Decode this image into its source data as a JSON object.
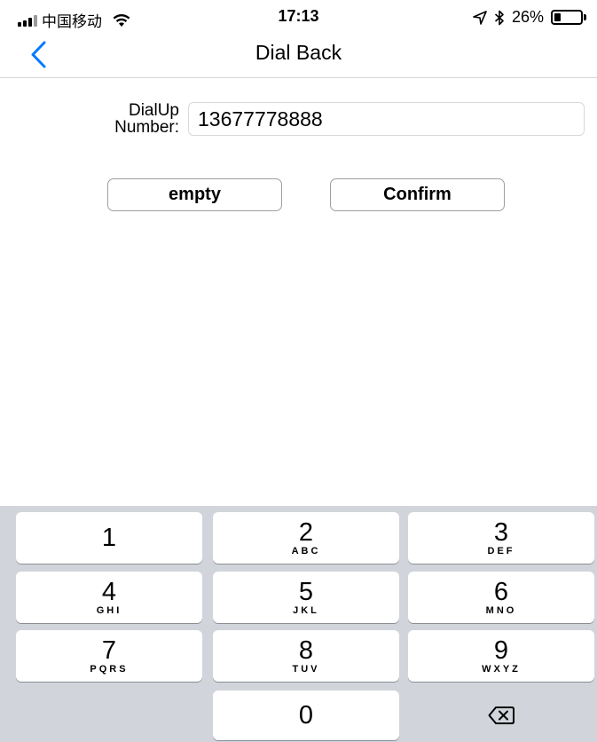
{
  "status_bar": {
    "carrier": "中国移动",
    "time": "17:13",
    "battery_text": "26%",
    "battery_level": 0.26,
    "icons": [
      "signal-icon",
      "wifi-icon",
      "location-icon",
      "bluetooth-icon",
      "battery-icon"
    ]
  },
  "nav": {
    "title": "Dial Back",
    "back_icon": "chevron-left-icon",
    "accent_color": "#007aff"
  },
  "form": {
    "label_line1": "DialUp",
    "label_line2": "Number:",
    "input_value": "13677778888"
  },
  "buttons": {
    "empty_label": "empty",
    "confirm_label": "Confirm"
  },
  "keypad": {
    "keys": [
      {
        "digit": "1",
        "letters": ""
      },
      {
        "digit": "2",
        "letters": "ABC"
      },
      {
        "digit": "3",
        "letters": "DEF"
      },
      {
        "digit": "4",
        "letters": "GHI"
      },
      {
        "digit": "5",
        "letters": "JKL"
      },
      {
        "digit": "6",
        "letters": "MNO"
      },
      {
        "digit": "7",
        "letters": "PQRS"
      },
      {
        "digit": "8",
        "letters": "TUV"
      },
      {
        "digit": "9",
        "letters": "WXYZ"
      },
      {
        "digit": "0",
        "letters": ""
      }
    ],
    "delete_icon": "backspace-icon"
  }
}
